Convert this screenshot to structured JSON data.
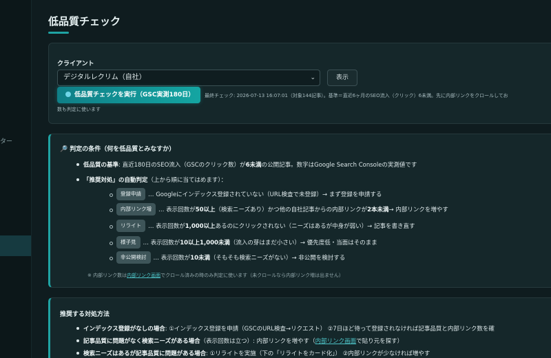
{
  "sidebar": {
    "fragment": "ター"
  },
  "page": {
    "title": "低品質チェック"
  },
  "client_panel": {
    "label": "クライアント",
    "selected_client": "デジタルレクリム（自社）",
    "show_button": "表示",
    "run_button": "低品質チェックを実行（GSC実測180日）",
    "last_check_line1": "最終チェック: 2026-07-13 16:07:01（対象144記事）。基準＝直近6ヶ月のSEO流入（クリック）6未満。先に内部リンクをクロールしてお",
    "last_check_line2": "数も判定に使います"
  },
  "criteria": {
    "icon": "magnifier-icon",
    "title": "判定の条件（何を低品質とみなすか）",
    "b1_label": "低品質の基準",
    "b1_a": ": 直近180日のSEO流入（GSCのクリック数）が",
    "b1_b": "6未満",
    "b1_c": "の公開記事。数字はGoogle Search Consoleの実測値です",
    "b2_label": "「推奨対処」の自動判定",
    "b2_rest": "（上から順に当てはめます）：",
    "rules": [
      {
        "tag": "登録申請",
        "a": "… Googleにインデックス登録されていない（URL検査で未登録）→ まず登録を申請する",
        "b": "",
        "c": "",
        "d": "",
        "e": ""
      },
      {
        "tag": "内部リンク増",
        "a": "… 表示回数が",
        "b": "50以上",
        "c": "（検索ニーズあり）かつ他の自社記事からの内部リンクが",
        "d": "2本未満",
        "e": "→ 内部リンクを増やす"
      },
      {
        "tag": "リライト",
        "a": "… 表示回数が",
        "b": "1,000以上",
        "c": "あるのにクリックされない（ニーズはあるが中身が弱い）→ 記事を書き直す",
        "d": "",
        "e": ""
      },
      {
        "tag": "様子見",
        "a": "… 表示回数が",
        "b": "10以上1,000未満",
        "c": "（流入の芽はまだ小さい）→ 優先度低・当面はそのまま",
        "d": "",
        "e": ""
      },
      {
        "tag": "非公開検討",
        "a": "… 表示回数が",
        "b": "10未満",
        "c": "（そもそも検索ニーズがない）→ 非公開を検討する",
        "d": "",
        "e": ""
      }
    ],
    "note_a": "※ 内部リンク数は",
    "note_link": "内部リンク画面",
    "note_b": "でクロール済みの時のみ判定に使います（未クロールなら内部リンク増は出ません）"
  },
  "actions": {
    "title": "推奨する対処方法",
    "i1_label": "インデックス登録がなしの場合",
    "i1_rest": ": ①インデックス登録を申請（GSCのURL検査→リクエスト） ②7日ほど待って登録されなければ記事品質と内部リンク数を確",
    "i2_label": "記事品質に問題がなく検索ニーズがある場合",
    "i2_a": "（表示回数は立つ）: 内部リンクを増やす（",
    "i2_link": "内部リンク画面",
    "i2_b": "で貼り元を探す）",
    "i3_label": "検索ニーズはあるが記事品質に問題がある場合",
    "i3_rest": ": ①リライトを実施（下の「リライトをカード化」） ②内部リンクが少なければ増やす"
  },
  "colors": {
    "accent": "#1fa3a3",
    "background": "#0f1c1f",
    "card": "#15272a"
  }
}
